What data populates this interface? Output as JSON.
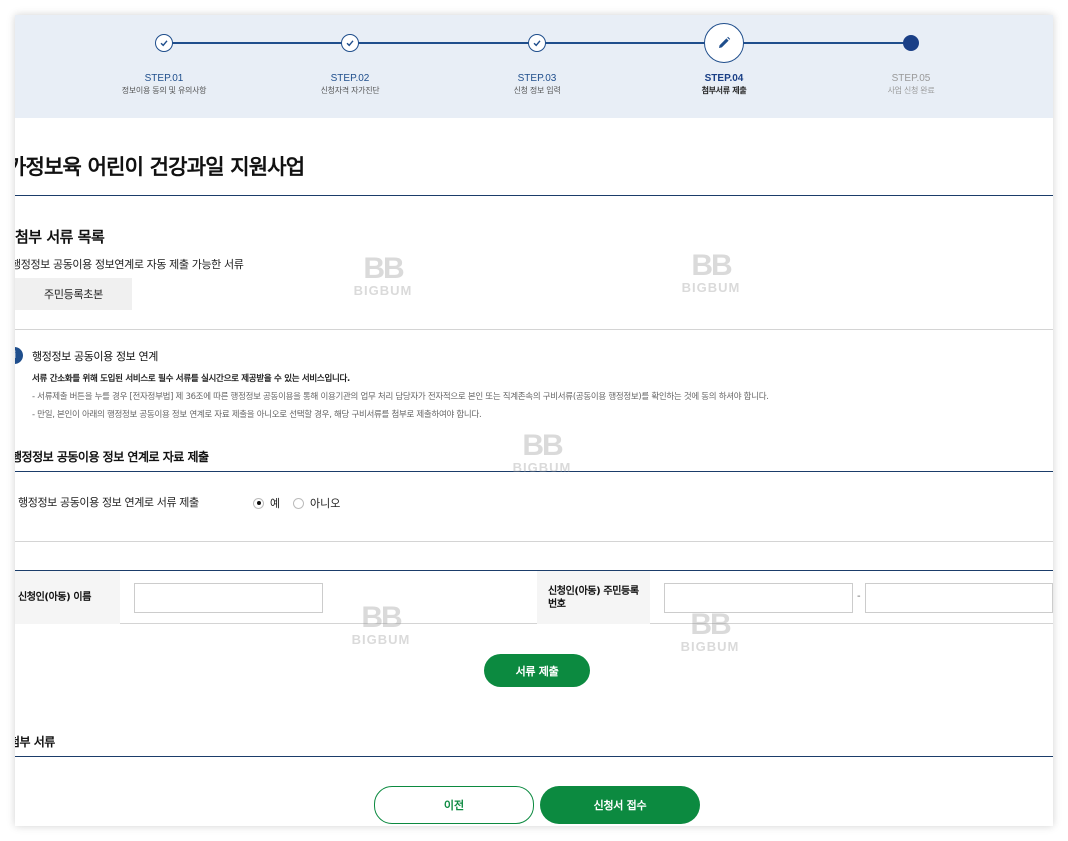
{
  "stepper": {
    "steps": [
      {
        "label": "STEP.01",
        "sub": "정보이용 동의 및 유의사항",
        "state": "done"
      },
      {
        "label": "STEP.02",
        "sub": "신청자격 자가진단",
        "state": "done"
      },
      {
        "label": "STEP.03",
        "sub": "신청 정보 입력",
        "state": "done"
      },
      {
        "label": "STEP.04",
        "sub": "첨부서류 제출",
        "state": "current"
      },
      {
        "label": "STEP.05",
        "sub": "사업 신청 완료",
        "state": "upcoming"
      }
    ],
    "icons": {
      "done": "check-icon",
      "current": "pencil-icon",
      "upcoming": "dot-icon"
    },
    "colors": {
      "accent": "#1f4e8c",
      "background": "#e8eef6"
    }
  },
  "page": {
    "title": "가정보육 어린이 건강과일 지원사업"
  },
  "attachments": {
    "title": "첨부 서류 목록",
    "auto_label": "행정정보 공동이용 정보연계로 자동 제출 가능한 서류",
    "documents": [
      "주민등록초본"
    ]
  },
  "info": {
    "icon": "info-icon",
    "icon_glyph": "i",
    "title": "행정정보 공동이용 정보 연계",
    "lines": [
      "서류 간소화를 위해 도입된 서비스로 필수 서류를 실시간으로 제공받을 수 있는 서비스입니다.",
      "- 서류제출 버튼을 누를 경우 [전자정부법] 제 36조에 따른 행정정보 공동이용을 통해 이용기관의 업무 처리 담당자가 전자적으로 본인 또는 직계존속의 구비서류(공동이용 행정정보)를 확인하는 것에 동의 하셔야 합니다.",
      "- 만일, 본인이 아래의 행정정보 공동이용 정보 연계로 자료 제출을 아니오로 선택할 경우, 해당 구비서류를 첨부로 제출하여야 합니다."
    ]
  },
  "submission": {
    "title": "행정정보 공동이용 정보 연계로 자료 제출",
    "question": "행정정보 공동이용 정보 연계로 서류 제출",
    "options": [
      {
        "label": "예",
        "selected": true
      },
      {
        "label": "아니오",
        "selected": false
      }
    ]
  },
  "form": {
    "name_label": "신청인(아동) 이름",
    "name_value": "",
    "rrn_label_line1": "신청인(아동) 주민등록",
    "rrn_label_line2": "번호",
    "rrn_first": "",
    "rrn_second": "",
    "dash": "-"
  },
  "buttons": {
    "submit_docs": "서류 제출",
    "prev": "이전",
    "apply": "신청서 접수"
  },
  "attached": {
    "title": "첨부 서류"
  },
  "watermark": {
    "mark": "BB",
    "word": "BIGBUM"
  },
  "colors": {
    "green": "#0c8a40",
    "navy": "#1b3d6a"
  }
}
